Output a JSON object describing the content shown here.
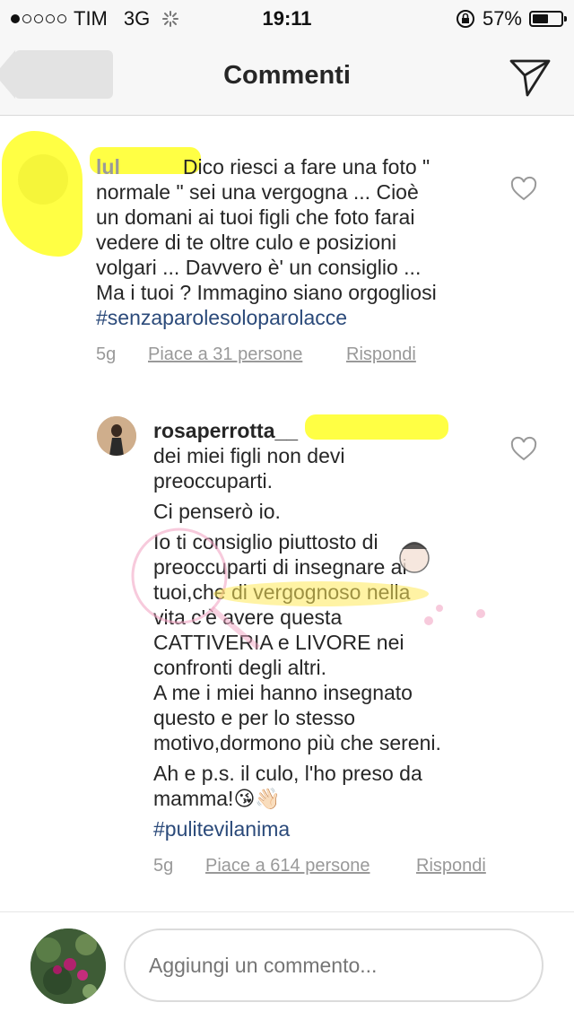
{
  "status_bar": {
    "carrier": "TIM",
    "network": "3G",
    "time": "19:11",
    "battery_percent": "57%",
    "battery_level": 0.57,
    "signal_bars_filled": 1
  },
  "header": {
    "title": "Commenti"
  },
  "comments": [
    {
      "username_partial": "lul",
      "text_lines": [
        "Dico riesci a fare una foto \"",
        "normale \" sei una vergogna ... Cioè",
        "un domani ai tuoi figli che foto farai",
        "vedere di te oltre culo e posizioni",
        "volgari ... Davvero è' un consiglio ...",
        "Ma i tuoi ? Immagino siano orgogliosi"
      ],
      "hashtag": "#senzaparolesoloparolacce",
      "age": "5g",
      "likes": "Piace a 31 persone",
      "reply": "Rispondi"
    },
    {
      "username": "rosaperrotta__",
      "text_lines": [
        "dei miei figli non devi",
        "preoccuparti.",
        "Ci penserò io.",
        "Io ti consiglio piuttosto di",
        "preoccuparti di insegnare ai",
        "tuoi,che di vergognoso nella",
        "vita c'è avere questa",
        "CATTIVERIA e LIVORE nei",
        "confronti degli altri.",
        "A me i miei hanno insegnato",
        "questo e per lo stesso",
        "motivo,dormono più che sereni.",
        "Ah e p.s. il culo, l'ho preso da",
        "mamma!😘👋🏻"
      ],
      "hashtag": "#pulitevilanima",
      "age": "5g",
      "likes": "Piace a 614 persone",
      "reply": "Rispondi"
    }
  ],
  "composer": {
    "placeholder": "Aggiungi un commento..."
  },
  "colors": {
    "hashtag": "#2b4a7a",
    "highlight": "#ffff3a",
    "meta_gray": "#999999"
  }
}
